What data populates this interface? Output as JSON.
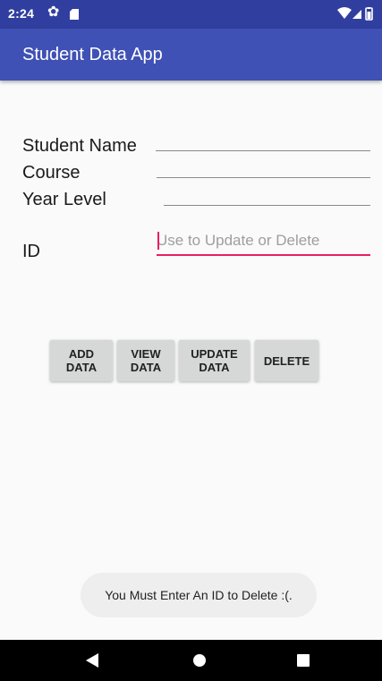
{
  "status_bar": {
    "time": "2:24",
    "icons": [
      "gear-icon",
      "sd-card-icon",
      "wifi-icon",
      "signal-icon",
      "battery-icon"
    ],
    "background": "#303f9f"
  },
  "app_bar": {
    "title": "Student Data App",
    "background": "#3f51b5"
  },
  "form": {
    "student_name_label": "Student Name",
    "course_label": "Course",
    "year_level_label": "Year Level",
    "id_label": "ID",
    "id_placeholder": "Use to Update or Delete",
    "id_value": "",
    "accent": "#e91e63"
  },
  "buttons": {
    "add": "ADD\nDATA",
    "view": "VIEW\nDATA",
    "update": "UPDATE\nDATA",
    "delete": "DELETE"
  },
  "toast": {
    "message": "You Must Enter An ID to Delete :(."
  },
  "nav_bar": {
    "icons": [
      "back-icon",
      "home-icon",
      "recents-icon"
    ]
  }
}
